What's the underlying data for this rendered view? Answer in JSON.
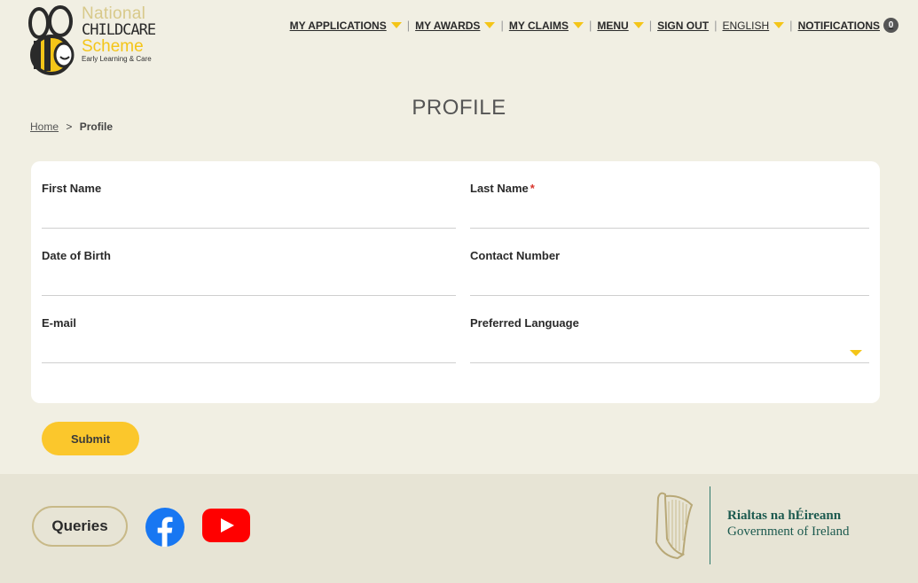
{
  "brand": {
    "line1": "National",
    "line2": "CHILDCARE",
    "line3": "Scheme",
    "line4": "Early Learning & Care",
    "colors": {
      "yellow": "#f4c518",
      "beige": "#d8c98a",
      "dark": "#2a2a2a"
    }
  },
  "nav": {
    "my_applications": "MY APPLICATIONS",
    "my_awards": "MY AWARDS",
    "my_claims": "MY CLAIMS",
    "menu": "MENU",
    "sign_out": "SIGN OUT",
    "language": "ENGLISH",
    "notifications": "NOTIFICATIONS",
    "notifications_count": "0"
  },
  "page": {
    "title": "PROFILE"
  },
  "breadcrumb": {
    "home": "Home",
    "separator": ">",
    "current": "Profile"
  },
  "form": {
    "first_name": {
      "label": "First Name",
      "value": ""
    },
    "last_name": {
      "label": "Last Name",
      "required_mark": "*",
      "value": ""
    },
    "dob": {
      "label": "Date of Birth",
      "value": ""
    },
    "contact": {
      "label": "Contact Number",
      "value": ""
    },
    "email": {
      "label": "E-mail",
      "value": ""
    },
    "language": {
      "label": "Preferred Language",
      "selected": ""
    },
    "submit_label": "Submit"
  },
  "footer": {
    "queries_label": "Queries",
    "facebook_icon": "facebook-icon",
    "youtube_icon": "youtube-icon",
    "gov_line1": "Rialtas na hÉireann",
    "gov_line2": "Government of Ireland"
  }
}
